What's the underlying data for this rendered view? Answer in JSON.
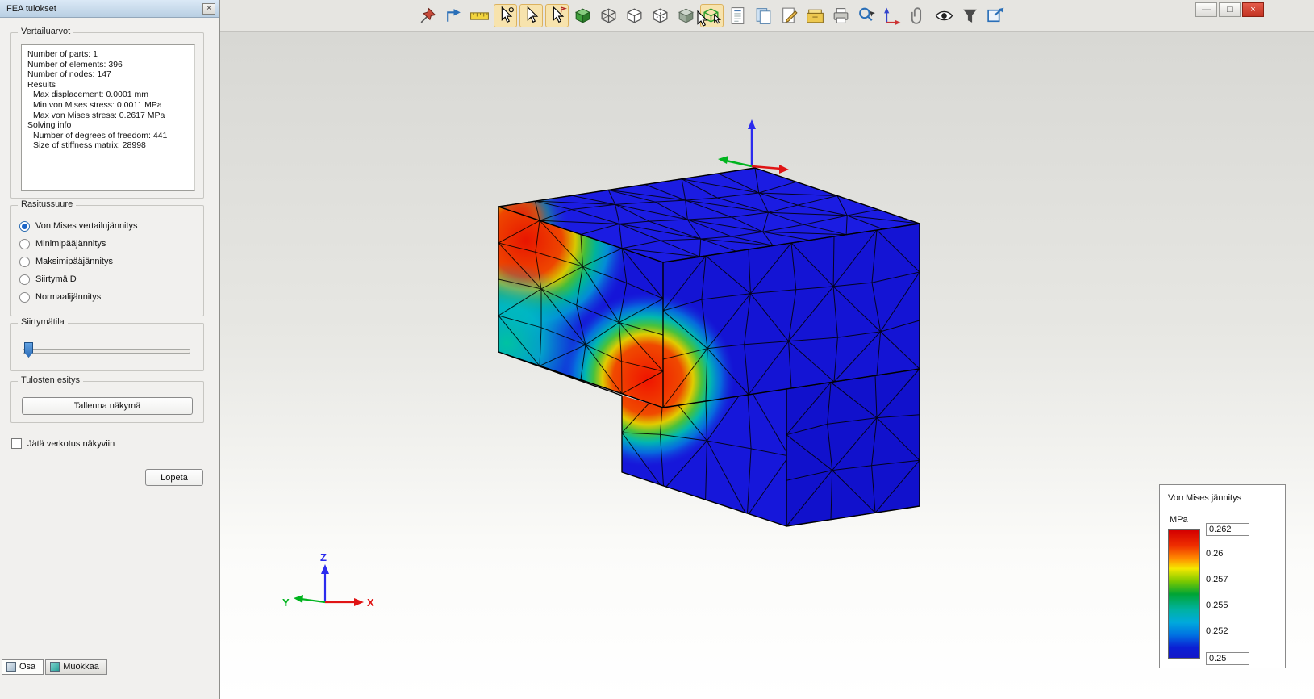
{
  "window": {
    "minimize_glyph": "—",
    "maximize_glyph": "□",
    "close_glyph": "×"
  },
  "panel": {
    "title": "FEA tulokset",
    "close_glyph": "×",
    "results_group": {
      "label": "Vertailuarvot",
      "lines": [
        {
          "text": "Number of parts: 1",
          "indent": 0
        },
        {
          "text": "Number of elements: 396",
          "indent": 0
        },
        {
          "text": "Number of nodes: 147",
          "indent": 0
        },
        {
          "text": "Results",
          "indent": 0
        },
        {
          "text": "Max displacement: 0.0001 mm",
          "indent": 1
        },
        {
          "text": "Min von Mises stress: 0.0011 MPa",
          "indent": 1
        },
        {
          "text": "Max von Mises stress: 0.2617 MPa",
          "indent": 1
        },
        {
          "text": "Solving info",
          "indent": 0
        },
        {
          "text": "Number of degrees of freedom: 441",
          "indent": 1
        },
        {
          "text": "Size of stiffness matrix: 28998",
          "indent": 1
        }
      ]
    },
    "stress_group": {
      "label": "Rasitussuure",
      "options": [
        {
          "label": "Von Mises vertailujännitys",
          "selected": true
        },
        {
          "label": "Minimipääjännitys",
          "selected": false
        },
        {
          "label": "Maksimipääjännitys",
          "selected": false
        },
        {
          "label": "Siirtymä D",
          "selected": false
        },
        {
          "label": "Normaalijännitys",
          "selected": false
        }
      ]
    },
    "displacement_group": {
      "label": "Siirtymätila"
    },
    "output_group": {
      "label": "Tulosten esitys",
      "save_view_label": "Tallenna näkymä"
    },
    "mesh_checkbox_label": "Jätä verkotus näkyviin",
    "quit_label": "Lopeta",
    "tabs": [
      {
        "label": "Osa",
        "active": true
      },
      {
        "label": "Muokkaa",
        "active": false
      }
    ]
  },
  "toolbar": {
    "icons": [
      {
        "name": "pin",
        "symbol": "pin",
        "boxed": false
      },
      {
        "name": "pan",
        "symbol": "pan",
        "boxed": false
      },
      {
        "name": "measure",
        "symbol": "ruler",
        "boxed": false
      },
      {
        "name": "snap-point",
        "symbol": "cursor-dot",
        "boxed": true
      },
      {
        "name": "select",
        "symbol": "cursor",
        "boxed": true
      },
      {
        "name": "snap-tangent",
        "symbol": "cursor-flag",
        "boxed": true
      },
      {
        "name": "shaded-view",
        "symbol": "cube-solid",
        "boxed": false
      },
      {
        "name": "wireframe-view",
        "symbol": "cube-wire",
        "boxed": false
      },
      {
        "name": "hidden-line-view",
        "symbol": "cube-outline",
        "boxed": false
      },
      {
        "name": "dashed-hidden-view",
        "symbol": "cube-dash",
        "boxed": false
      },
      {
        "name": "rendered-view",
        "symbol": "cube-shade",
        "boxed": false
      },
      {
        "name": "select-body",
        "symbol": "cube-select",
        "boxed": true
      },
      {
        "name": "report",
        "symbol": "report",
        "boxed": false
      },
      {
        "name": "copy",
        "symbol": "copy",
        "boxed": false
      },
      {
        "name": "sketch",
        "symbol": "page-pen",
        "boxed": false
      },
      {
        "name": "archive",
        "symbol": "archive",
        "boxed": false
      },
      {
        "name": "print",
        "symbol": "printer",
        "boxed": false
      },
      {
        "name": "zoom-select",
        "symbol": "zoom-cursor",
        "boxed": false
      },
      {
        "name": "coordinate-axes",
        "symbol": "axes",
        "boxed": false
      },
      {
        "name": "attach",
        "symbol": "clip",
        "boxed": false
      },
      {
        "name": "visibility",
        "symbol": "eye",
        "boxed": false
      },
      {
        "name": "filter",
        "symbol": "funnel",
        "boxed": false
      },
      {
        "name": "new-window",
        "symbol": "window-arrow",
        "boxed": false
      }
    ]
  },
  "viewport": {
    "triad": {
      "x": "X",
      "y": "Y",
      "z": "Z"
    }
  },
  "legend": {
    "title": "Von Mises jännitys",
    "unit": "MPa",
    "values": [
      "0.262",
      "0.26",
      "0.257",
      "0.255",
      "0.252",
      "0.25"
    ]
  }
}
